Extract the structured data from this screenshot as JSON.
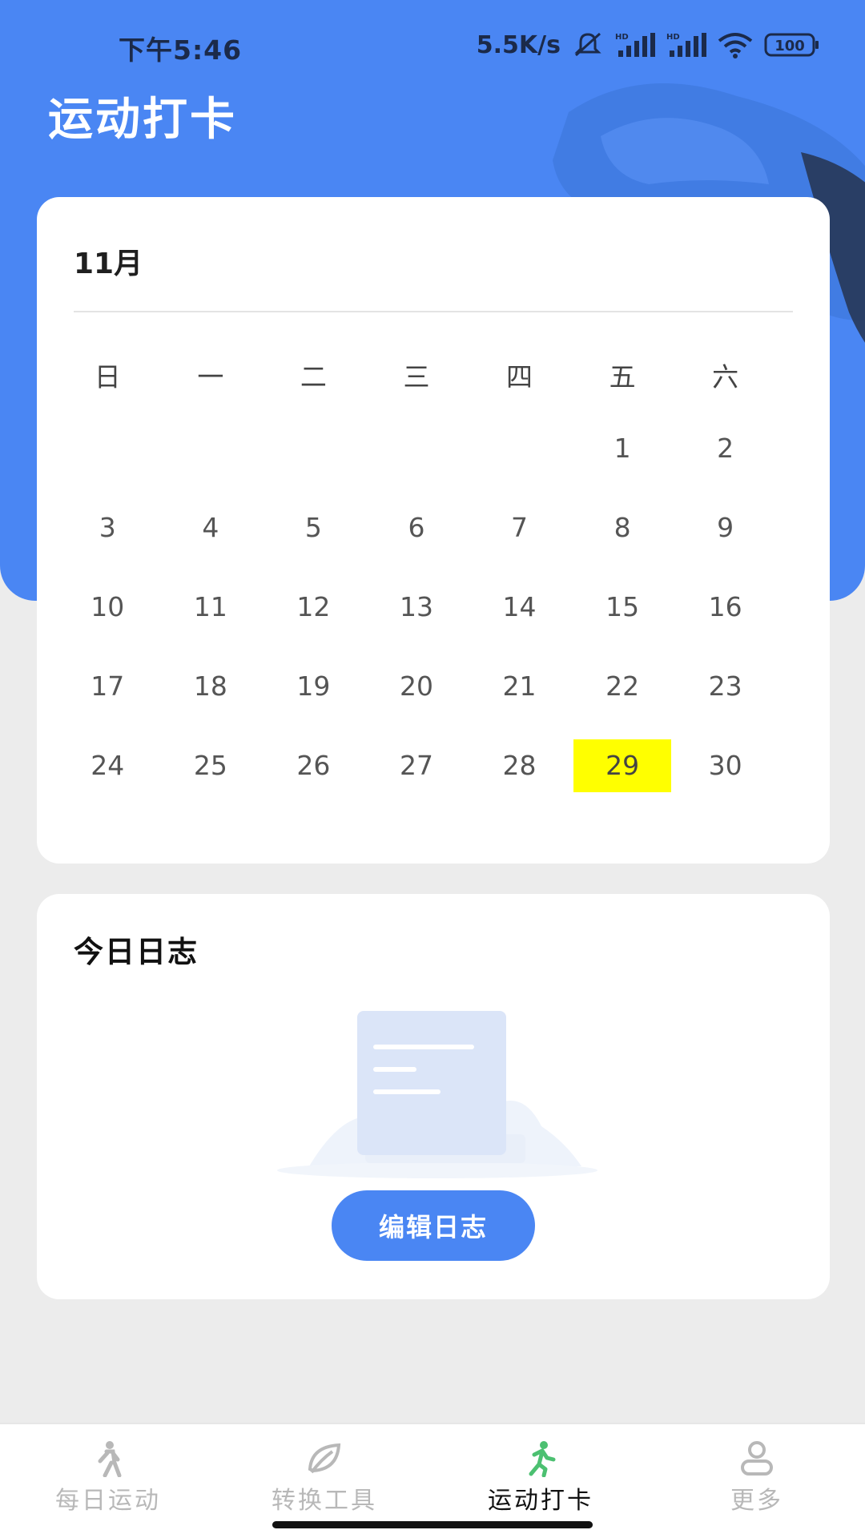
{
  "status_bar": {
    "time": "下午5:46",
    "network_speed": "5.5K/s",
    "battery": "100",
    "icons": [
      "mute-icon",
      "hd-signal-icon",
      "hd-signal-icon",
      "wifi-icon",
      "battery-icon"
    ]
  },
  "header": {
    "title": "运动打卡"
  },
  "calendar": {
    "month": "11月",
    "weekdays": [
      "日",
      "一",
      "二",
      "三",
      "四",
      "五",
      "六"
    ],
    "weeks": [
      [
        "",
        "",
        "",
        "",
        "",
        "1",
        "2"
      ],
      [
        "3",
        "4",
        "5",
        "6",
        "7",
        "8",
        "9"
      ],
      [
        "10",
        "11",
        "12",
        "13",
        "14",
        "15",
        "16"
      ],
      [
        "17",
        "18",
        "19",
        "20",
        "21",
        "22",
        "23"
      ],
      [
        "24",
        "25",
        "26",
        "27",
        "28",
        "29",
        "30"
      ]
    ],
    "highlighted_day": "29",
    "highlight_color": "#ffff00"
  },
  "journal": {
    "title": "今日日志",
    "edit_button": "编辑日志",
    "empty_icon": "empty-document-icon"
  },
  "tabbar": {
    "tabs": [
      {
        "label": "每日运动",
        "icon": "walking-person-icon",
        "active": false
      },
      {
        "label": "转换工具",
        "icon": "leaf-icon",
        "active": false
      },
      {
        "label": "运动打卡",
        "icon": "running-person-icon",
        "active": true
      },
      {
        "label": "更多",
        "icon": "user-icon",
        "active": false
      }
    ]
  },
  "colors": {
    "primary": "#4a86f3",
    "active_tab_icon": "#4cc071",
    "inactive_tab": "#b8b8b8",
    "background": "#ececec"
  }
}
